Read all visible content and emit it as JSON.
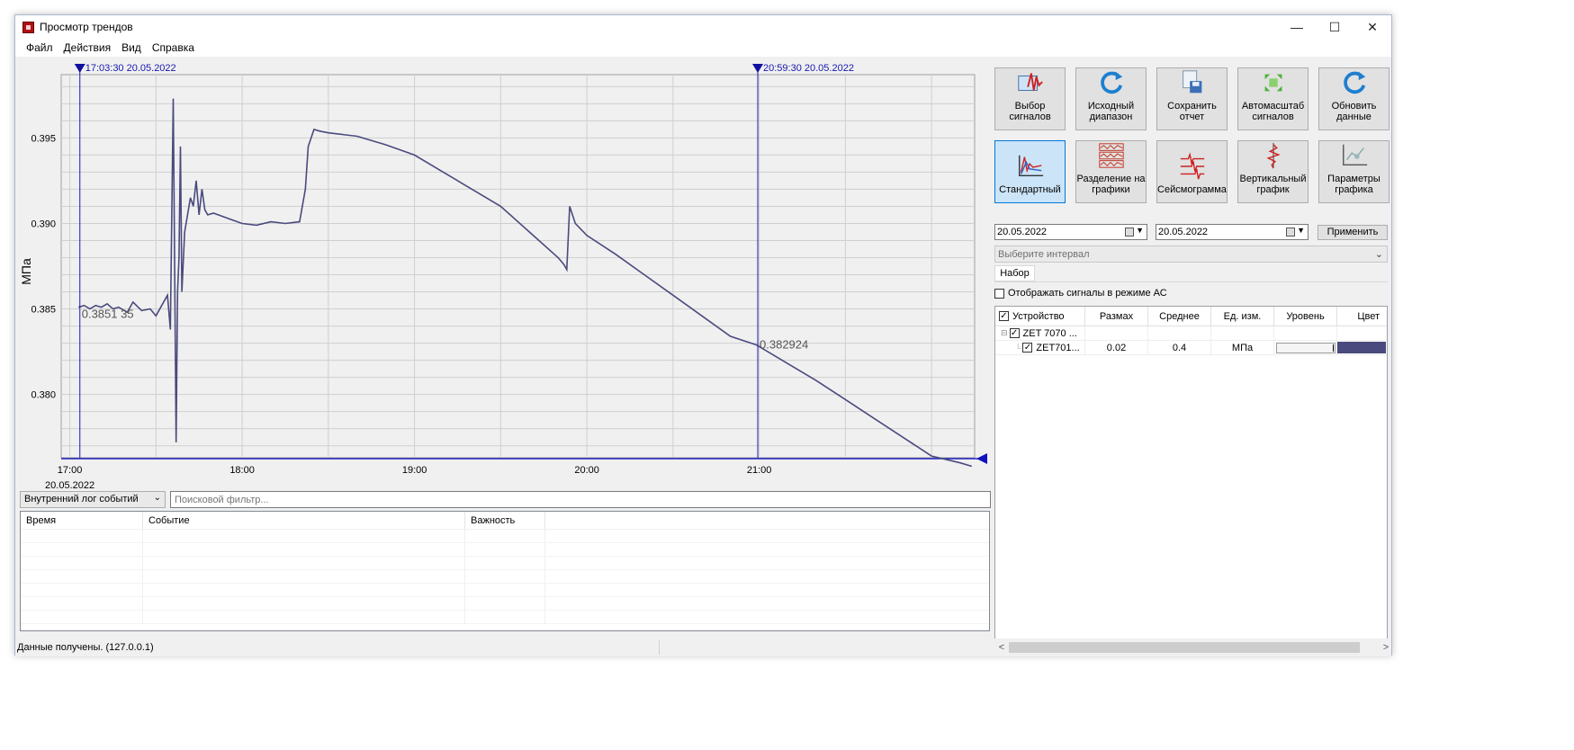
{
  "window": {
    "title": "Просмотр трендов",
    "controls": {
      "minimize": "—",
      "maximize": "☐",
      "close": "✕"
    }
  },
  "menu": [
    "Файл",
    "Действия",
    "Вид",
    "Справка"
  ],
  "chart_data": {
    "type": "line",
    "ylabel": "МПа",
    "y_ticks": [
      "0.395",
      "0.390",
      "0.385",
      "0.380"
    ],
    "y_tick_values": [
      0.395,
      0.39,
      0.385,
      0.38
    ],
    "ylim": [
      0.3763,
      0.3987
    ],
    "x_ticks": [
      "17:00",
      "18:00",
      "19:00",
      "20:00",
      "21:00"
    ],
    "x_date_label": "20.05.2022",
    "xlim": [
      "16:57",
      "22:15"
    ],
    "cursor_left": {
      "label": "17:03:30 20.05.2022",
      "time": "17:03:30",
      "value_label": "0.3851 35"
    },
    "cursor_right": {
      "label": "20:59:30 20.05.2022",
      "time": "20:59:30",
      "value_label": "0.382924"
    },
    "grid": true,
    "line_color": "#4a4a7e",
    "series": [
      {
        "x": [
          "17:03",
          "17:05",
          "17:07",
          "17:09",
          "17:11",
          "17:13",
          "17:15",
          "17:17",
          "17:20",
          "17:22",
          "17:25",
          "17:28",
          "17:30",
          "17:32",
          "17:34",
          "17:35",
          "17:36",
          "17:37",
          "17:37.5",
          "17:38",
          "17:38.5",
          "17:39",
          "17:40",
          "17:41",
          "17:42",
          "17:43",
          "17:44",
          "17:45",
          "17:46",
          "17:47",
          "17:48",
          "17:50",
          "17:55",
          "18:00",
          "18:05",
          "18:10",
          "18:15",
          "18:20",
          "18:22",
          "18:23",
          "18:25",
          "18:27",
          "18:30",
          "18:40",
          "18:50",
          "19:00",
          "19:10",
          "19:20",
          "19:30",
          "19:40",
          "19:50",
          "19:52",
          "19:53",
          "19:54",
          "19:56",
          "20:00",
          "20:10",
          "20:20",
          "20:30",
          "20:40",
          "20:50",
          "20:59",
          "21:10",
          "21:20",
          "21:30",
          "21:40",
          "21:50",
          "22:00",
          "22:10",
          "22:14"
        ],
        "y": [
          0.3851,
          0.3852,
          0.385,
          0.3852,
          0.3851,
          0.3853,
          0.385,
          0.3851,
          0.3848,
          0.3854,
          0.3849,
          0.385,
          0.3846,
          0.3852,
          0.3858,
          0.3838,
          0.3973,
          0.3772,
          0.386,
          0.388,
          0.3945,
          0.386,
          0.3895,
          0.3905,
          0.3915,
          0.391,
          0.3925,
          0.3905,
          0.392,
          0.3908,
          0.3905,
          0.3906,
          0.3903,
          0.39,
          0.3899,
          0.3901,
          0.39,
          0.3901,
          0.392,
          0.3945,
          0.3955,
          0.3954,
          0.3953,
          0.3951,
          0.3946,
          0.394,
          0.393,
          0.392,
          0.391,
          0.3895,
          0.388,
          0.3876,
          0.3873,
          0.391,
          0.39,
          0.3893,
          0.3882,
          0.387,
          0.3858,
          0.3846,
          0.3834,
          0.3829,
          0.3818,
          0.3808,
          0.3797,
          0.3786,
          0.3775,
          0.3764,
          0.376,
          0.3758
        ]
      }
    ]
  },
  "log": {
    "select_label": "Внутренний лог событий",
    "search_placeholder": "Поисковой фильтр...",
    "columns": [
      "Время",
      "Событие",
      "Важность"
    ]
  },
  "status": {
    "text": "Данные получены. (127.0.0.1)"
  },
  "toolbar": {
    "row1": [
      {
        "label": "Выбор сигналов",
        "icon": "signal-select-icon"
      },
      {
        "label": "Исходный диапазон",
        "icon": "reset-range-icon"
      },
      {
        "label": "Сохранить отчет",
        "icon": "save-report-icon"
      },
      {
        "label": "Автомасштаб сигналов",
        "icon": "autoscale-icon"
      },
      {
        "label": "Обновить данные",
        "icon": "refresh-icon"
      }
    ],
    "row2": [
      {
        "label": "Стандартный",
        "icon": "standard-chart-icon",
        "active": true
      },
      {
        "label": "Разделение на графики",
        "icon": "split-charts-icon"
      },
      {
        "label": "Сейсмограмма",
        "icon": "seismogram-icon"
      },
      {
        "label": "Вертикальный график",
        "icon": "vertical-chart-icon"
      },
      {
        "label": "Параметры графика",
        "icon": "chart-params-icon"
      }
    ]
  },
  "dates": {
    "from": "20.05.2022",
    "to": "20.05.2022",
    "apply_label": "Применить"
  },
  "interval": {
    "placeholder": "Выберите интервал"
  },
  "tabs": {
    "set": "Набор"
  },
  "ac_mode": {
    "label": "Отображать сигналы в режиме АС",
    "checked": false
  },
  "signals": {
    "columns": [
      "Устройство",
      "Размах",
      "Среднее",
      "Ед. изм.",
      "Уровень",
      "Цвет"
    ],
    "device": {
      "name": "ZET 7070 ...",
      "checked": true
    },
    "rows": [
      {
        "name": "ZET701...",
        "checked": true,
        "range": "0.02",
        "mean": "0.4",
        "unit": "МПа",
        "level": 0.97,
        "color": "#4a4a7e"
      }
    ]
  }
}
